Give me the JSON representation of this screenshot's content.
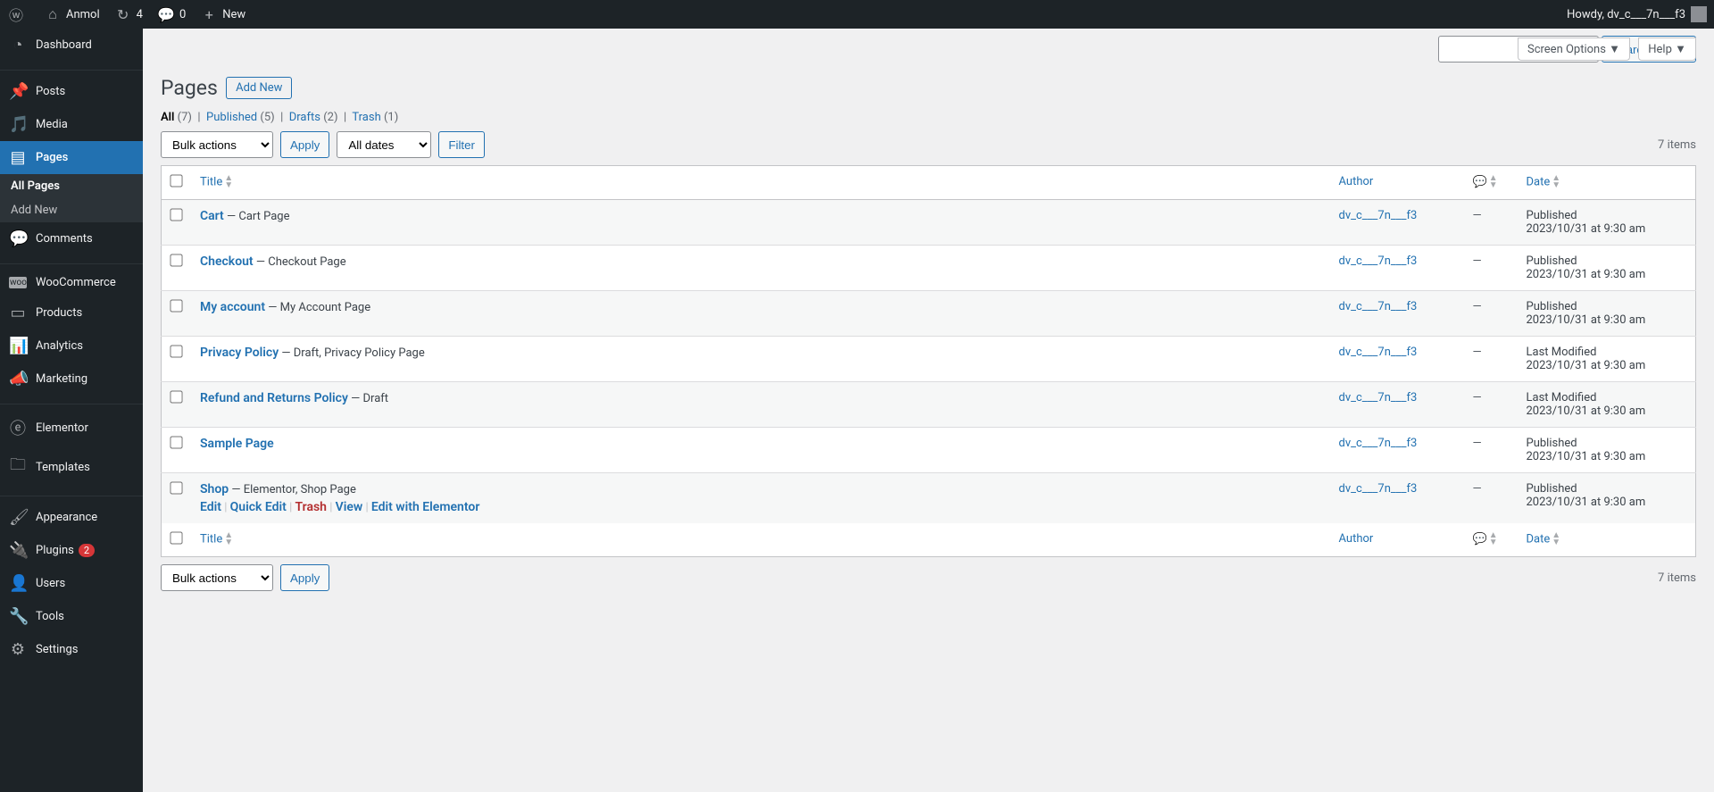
{
  "adminbar": {
    "site_name": "Anmol",
    "updates": "4",
    "comments": "0",
    "new": "New",
    "howdy": "Howdy, dv_c___7n___f3"
  },
  "menu": {
    "dashboard": "Dashboard",
    "posts": "Posts",
    "media": "Media",
    "pages": "Pages",
    "all_pages": "All Pages",
    "add_new_page": "Add New",
    "comments": "Comments",
    "woocommerce": "WooCommerce",
    "products": "Products",
    "analytics": "Analytics",
    "marketing": "Marketing",
    "elementor": "Elementor",
    "templates": "Templates",
    "appearance": "Appearance",
    "plugins": "Plugins",
    "plugins_badge": "2",
    "users": "Users",
    "tools": "Tools",
    "settings": "Settings"
  },
  "header": {
    "screen_options": "Screen Options ▼",
    "help": "Help ▼",
    "title": "Pages",
    "add_new": "Add New"
  },
  "filters": {
    "all_label": "All",
    "all_count": "(7)",
    "published_label": "Published",
    "published_count": "(5)",
    "drafts_label": "Drafts",
    "drafts_count": "(2)",
    "trash_label": "Trash",
    "trash_count": "(1)"
  },
  "search": {
    "button": "Search Pages"
  },
  "bulk": {
    "bulk_actions": "Bulk actions",
    "apply": "Apply",
    "all_dates": "All dates",
    "filter": "Filter",
    "item_count": "7 items"
  },
  "columns": {
    "title": "Title",
    "author": "Author",
    "date": "Date"
  },
  "rows": [
    {
      "title": "Cart",
      "suffix": " — Cart Page",
      "author": "dv_c___7n___f3",
      "comments": "—",
      "state": "Published",
      "date": "2023/10/31 at 9:30 am",
      "actions": false
    },
    {
      "title": "Checkout",
      "suffix": " — Checkout Page",
      "author": "dv_c___7n___f3",
      "comments": "—",
      "state": "Published",
      "date": "2023/10/31 at 9:30 am",
      "actions": false
    },
    {
      "title": "My account",
      "suffix": " — My Account Page",
      "author": "dv_c___7n___f3",
      "comments": "—",
      "state": "Published",
      "date": "2023/10/31 at 9:30 am",
      "actions": false
    },
    {
      "title": "Privacy Policy",
      "suffix": " — Draft, Privacy Policy Page",
      "author": "dv_c___7n___f3",
      "comments": "—",
      "state": "Last Modified",
      "date": "2023/10/31 at 9:30 am",
      "actions": false
    },
    {
      "title": "Refund and Returns Policy",
      "suffix": " — Draft",
      "author": "dv_c___7n___f3",
      "comments": "—",
      "state": "Last Modified",
      "date": "2023/10/31 at 9:30 am",
      "actions": false
    },
    {
      "title": "Sample Page",
      "suffix": "",
      "author": "dv_c___7n___f3",
      "comments": "—",
      "state": "Published",
      "date": "2023/10/31 at 9:30 am",
      "actions": false
    },
    {
      "title": "Shop",
      "suffix": " — Elementor, Shop Page",
      "author": "dv_c___7n___f3",
      "comments": "—",
      "state": "Published",
      "date": "2023/10/31 at 9:30 am",
      "actions": true
    }
  ],
  "row_actions": {
    "edit": "Edit",
    "quick_edit": "Quick Edit",
    "trash": "Trash",
    "view": "View",
    "edit_elementor": "Edit with Elementor"
  }
}
